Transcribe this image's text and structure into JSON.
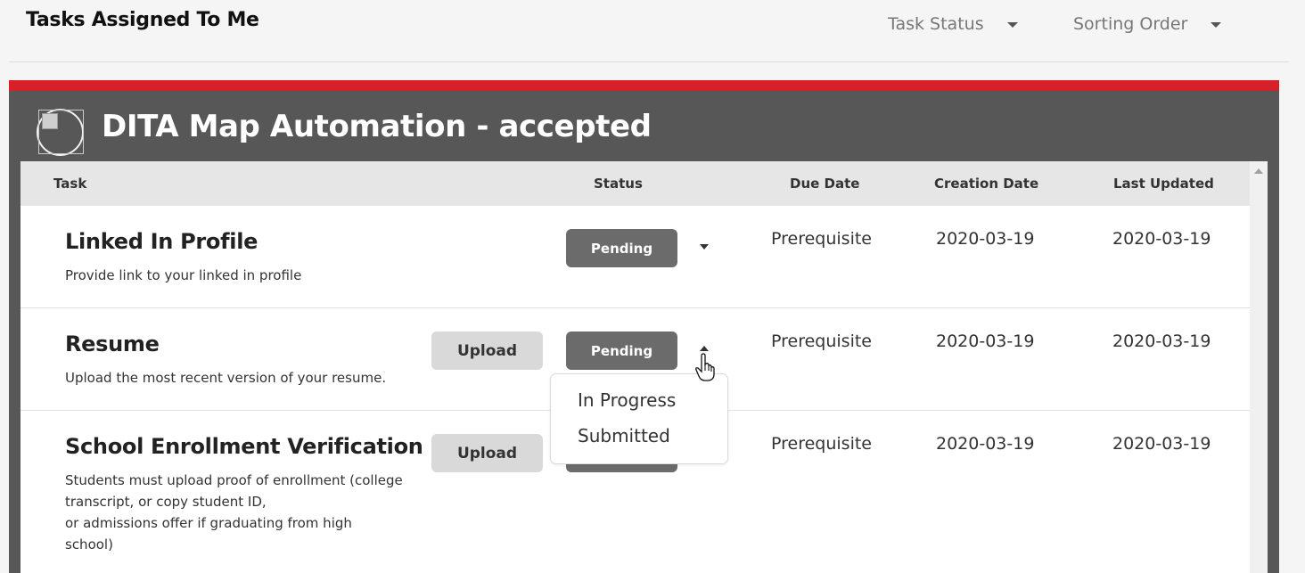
{
  "header": {
    "title": "Tasks Assigned To Me",
    "filters": [
      {
        "label": "Task Status"
      },
      {
        "label": "Sorting Order"
      }
    ]
  },
  "colors": {
    "accent_strip": "#d72027",
    "panel_bg": "#575757",
    "status_button": "#6b6b6b",
    "upload_button": "#d9d9d9"
  },
  "panel": {
    "title": "DITA Map Automation - accepted",
    "icon": "broken-image-icon"
  },
  "table": {
    "columns": [
      "Task",
      "Status",
      "Due Date",
      "Creation Date",
      "Last Updated"
    ],
    "rows": [
      {
        "title": "Linked In Profile",
        "description": "Provide link to your linked in profile",
        "upload_label": "",
        "status": "Pending",
        "due": "Prerequisite",
        "created": "2020-03-19",
        "updated": "2020-03-19"
      },
      {
        "title": "Resume",
        "description": "Upload the most recent version of your resume.",
        "upload_label": "Upload",
        "status": "Pending",
        "due": "Prerequisite",
        "created": "2020-03-19",
        "updated": "2020-03-19"
      },
      {
        "title": "School Enrollment Verification",
        "description_lines": [
          "Students must upload proof of enrollment (college",
          "transcript, or copy student ID,",
          "or admissions offer if graduating from high",
          "school)"
        ],
        "upload_label": "Upload",
        "status": "Pending",
        "due": "Prerequisite",
        "created": "2020-03-19",
        "updated": "2020-03-19"
      }
    ]
  },
  "status_dropdown": {
    "options": [
      "In Progress",
      "Submitted"
    ]
  }
}
